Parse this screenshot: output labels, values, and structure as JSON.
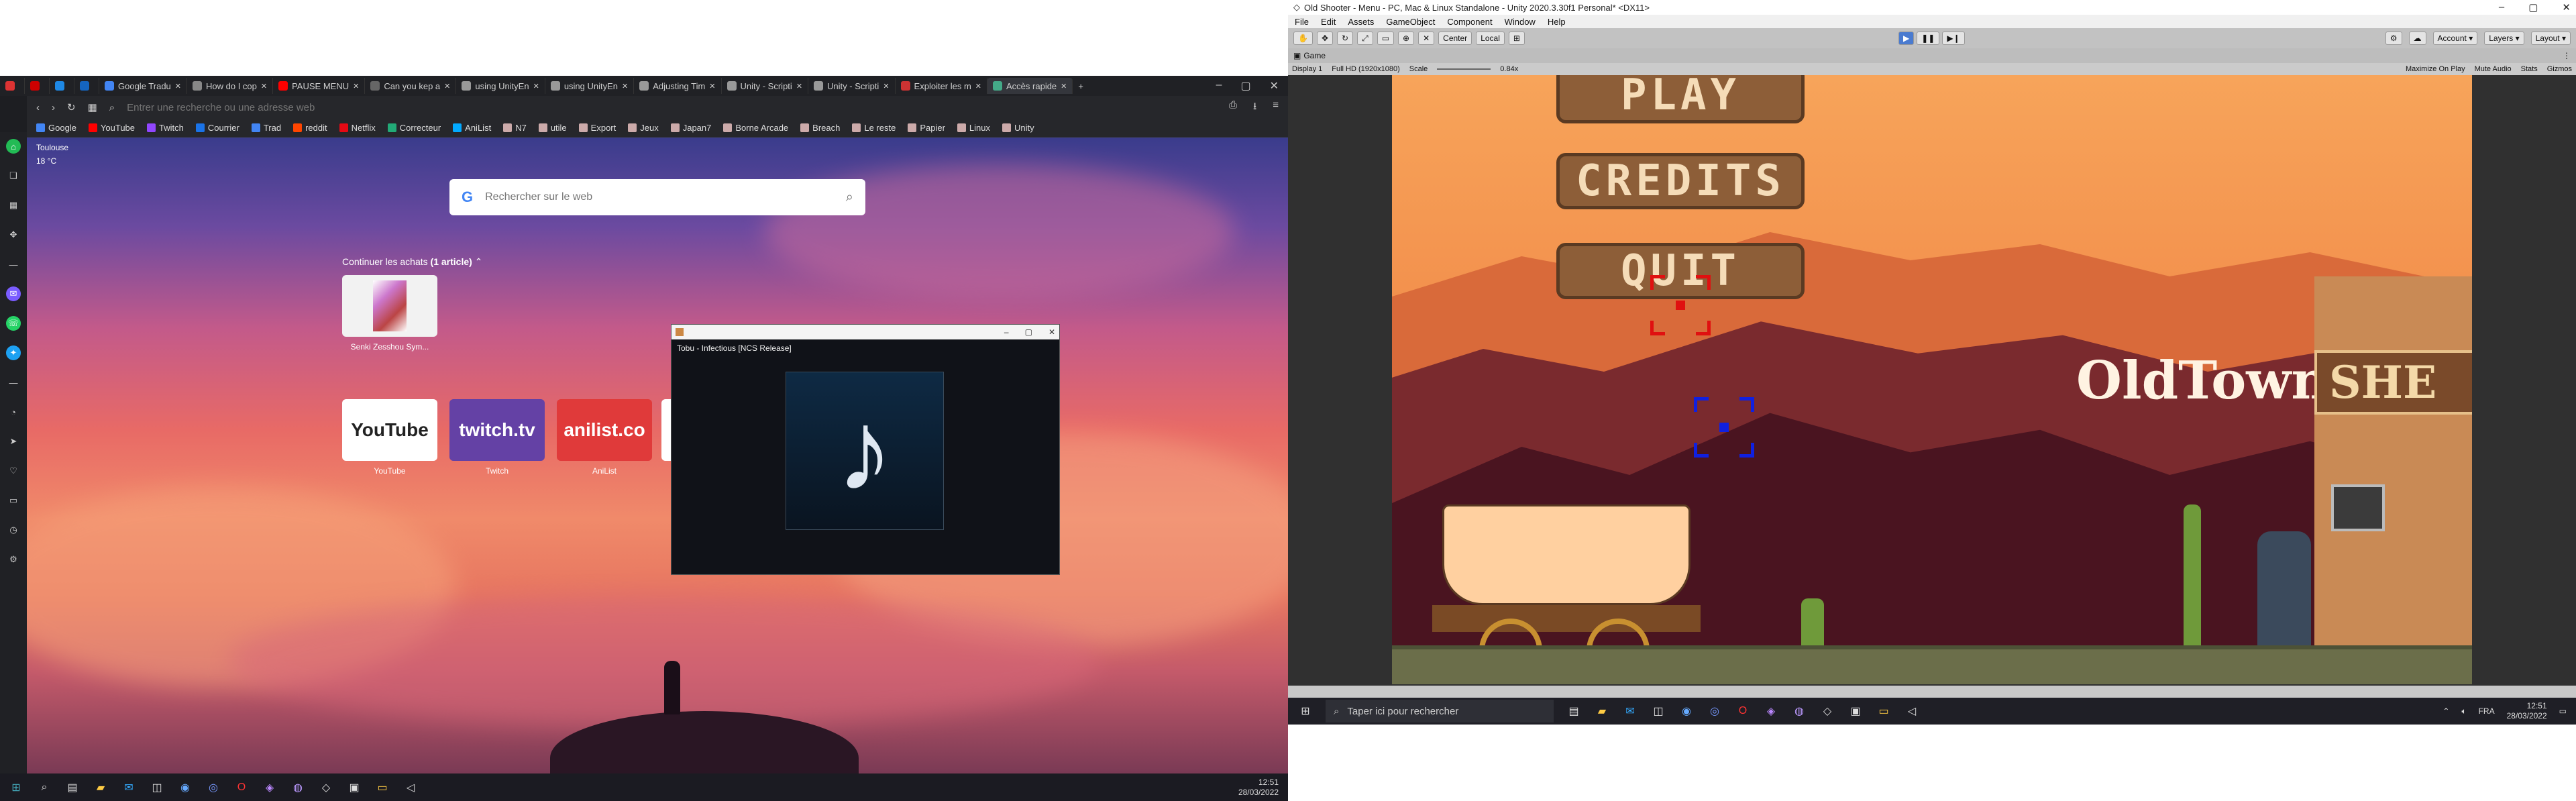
{
  "opera": {
    "tabs": [
      {
        "label": "",
        "icon": "opera-icon",
        "color": "#d33"
      },
      {
        "label": "",
        "icon": "favicon",
        "color": "#c00"
      },
      {
        "label": "",
        "icon": "favicon",
        "color": "#1e88e5"
      },
      {
        "label": "",
        "icon": "favicon",
        "color": "#1565c0"
      },
      {
        "label": "Google Tradu",
        "icon": "favicon",
        "color": "#4285f4"
      },
      {
        "label": "How do I cop",
        "icon": "favicon",
        "color": "#888"
      },
      {
        "label": "PAUSE MENU",
        "icon": "youtube-icon",
        "color": "#f00"
      },
      {
        "label": "Can you kep a",
        "icon": "favicon",
        "color": "#666"
      },
      {
        "label": "using UnityEn",
        "icon": "unity-icon",
        "color": "#999"
      },
      {
        "label": "using UnityEn",
        "icon": "unity-icon",
        "color": "#999"
      },
      {
        "label": "Adjusting Tim",
        "icon": "unity-icon",
        "color": "#999"
      },
      {
        "label": "Unity - Scripti",
        "icon": "unity-icon",
        "color": "#999"
      },
      {
        "label": "Unity - Scripti",
        "icon": "unity-icon",
        "color": "#999"
      },
      {
        "label": "Exploiter les m",
        "icon": "favicon",
        "color": "#c33"
      },
      {
        "label": "Accès rapide",
        "icon": "speed-dial-icon",
        "color": "#4a8",
        "active": true
      }
    ],
    "window_controls": [
      "–",
      "▢",
      "✕"
    ],
    "address_placeholder": "Entrer une recherche ou une adresse web",
    "bookmarks": [
      {
        "label": "Google",
        "color": "#4285f4"
      },
      {
        "label": "YouTube",
        "color": "#f00"
      },
      {
        "label": "Twitch",
        "color": "#9146ff"
      },
      {
        "label": "Courrier",
        "color": "#1a73e8"
      },
      {
        "label": "Trad",
        "color": "#4285f4"
      },
      {
        "label": "reddit",
        "color": "#ff4500"
      },
      {
        "label": "Netflix",
        "color": "#e50914"
      },
      {
        "label": "Correcteur",
        "color": "#2a7"
      },
      {
        "label": "AniList",
        "color": "#02a9ff"
      },
      {
        "label": "N7",
        "color": "#caa"
      },
      {
        "label": "utile",
        "color": "#caa"
      },
      {
        "label": "Export",
        "color": "#caa"
      },
      {
        "label": "Jeux",
        "color": "#caa"
      },
      {
        "label": "Japan7",
        "color": "#caa"
      },
      {
        "label": "Borne Arcade",
        "color": "#caa"
      },
      {
        "label": "Breach",
        "color": "#caa"
      },
      {
        "label": "Le reste",
        "color": "#caa"
      },
      {
        "label": "Papier",
        "color": "#caa"
      },
      {
        "label": "Linux",
        "color": "#caa"
      },
      {
        "label": "Unity",
        "color": "#caa"
      }
    ],
    "weather": {
      "city": "Toulouse",
      "temp": "18 °C"
    },
    "search_placeholder": "Rechercher sur le web",
    "continue_label": "Continuer les achats",
    "continue_count": "(1 article)",
    "card_caption": "Senki Zesshou Sym...",
    "speed_dials": [
      {
        "label": "YouTube",
        "text": "YouTube",
        "bg": "#ffffff",
        "fg": "#222"
      },
      {
        "label": "Twitch",
        "text": "twitch.tv",
        "bg": "#6441a5",
        "fg": "#fff"
      },
      {
        "label": "AniList",
        "text": "anilist.co",
        "bg": "#e03a3a",
        "fg": "#fff"
      }
    ],
    "player": {
      "window_title": "",
      "song": "Tobu - Infectious [NCS Release]"
    },
    "taskbar_clock": {
      "time": "12:51",
      "date": "28/03/2022"
    }
  },
  "unity": {
    "title": "Old Shooter - Menu - PC, Mac & Linux Standalone - Unity 2020.3.30f1 Personal* <DX11>",
    "menu": [
      "File",
      "Edit",
      "Assets",
      "GameObject",
      "Component",
      "Window",
      "Help"
    ],
    "tool_labels": {
      "center": "Center",
      "local": "Local"
    },
    "right_tools": {
      "account": "Account",
      "layers": "Layers",
      "layout": "Layout"
    },
    "game_tab": "Game",
    "game_bar": {
      "display": "Display 1",
      "resolution": "Full HD (1920x1080)",
      "scale_label": "Scale",
      "scale_value": "0.84x",
      "right": [
        "Maximize On Play",
        "Mute Audio",
        "Stats",
        "Gizmos"
      ]
    },
    "game": {
      "buttons": [
        "PLAY",
        "CREDITS",
        "QUIT"
      ],
      "title": "OldTown",
      "sign": "SHE"
    },
    "colors": {
      "target_red": "#e01010",
      "target_blue": "#1020e0"
    }
  },
  "taskbar_right": {
    "search_placeholder": "Taper ici pour rechercher",
    "lang": "FRA",
    "time": "12:51",
    "date": "28/03/2022"
  }
}
